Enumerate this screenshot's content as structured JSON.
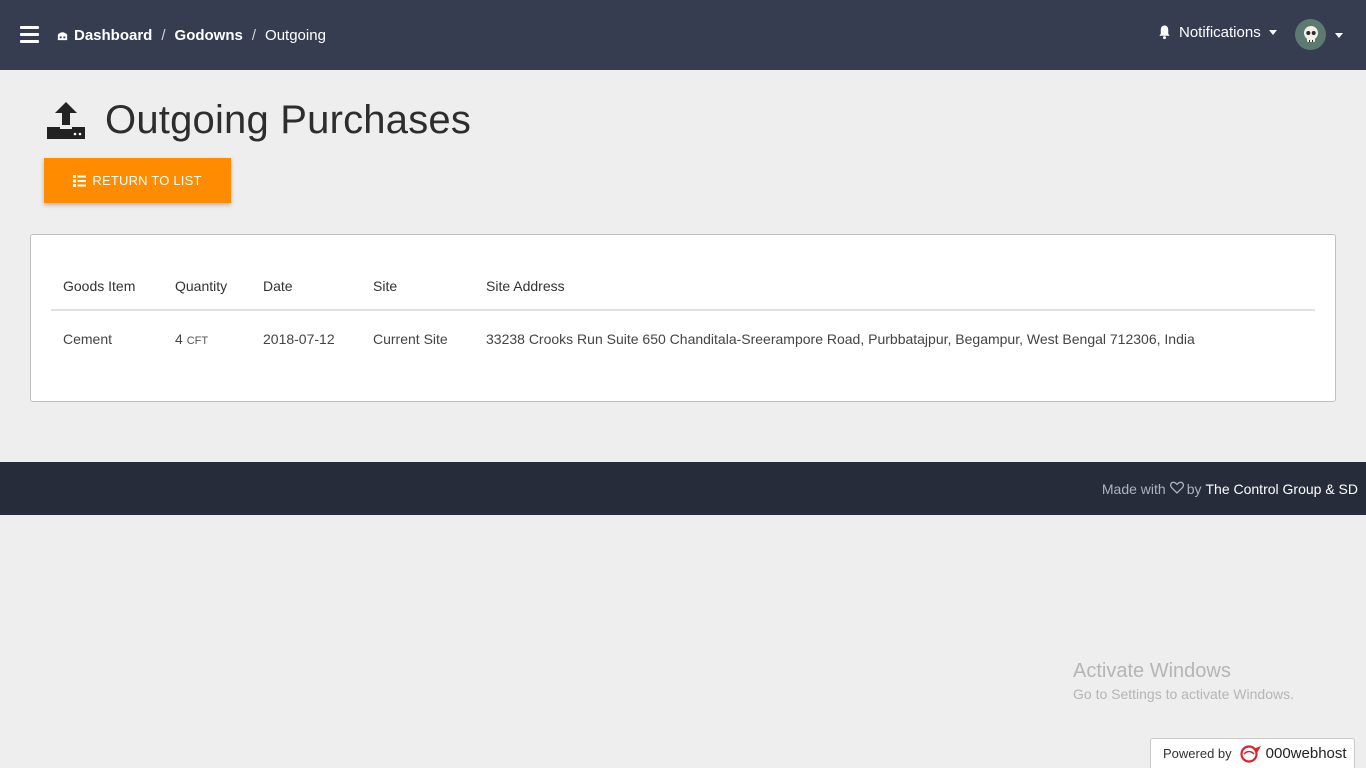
{
  "navbar": {
    "breadcrumb": {
      "home": "Dashboard",
      "parent": "Godowns",
      "current": "Outgoing",
      "separator": "/"
    },
    "notifications_label": "Notifications"
  },
  "header": {
    "title": "Outgoing Purchases",
    "return_button": "RETURN TO LIST"
  },
  "table": {
    "columns": [
      "Goods Item",
      "Quantity",
      "Date",
      "Site",
      "Site Address"
    ],
    "rows": [
      {
        "goods_item": "Cement",
        "quantity": "4",
        "unit": "CFT",
        "date": "2018-07-12",
        "site": "Current Site",
        "site_address": "33238 Crooks Run Suite 650 Chanditala-Sreerampore Road, Purbbatajpur, Begampur, West Bengal 712306, India"
      }
    ]
  },
  "footer": {
    "made_with": "Made with",
    "by": "by",
    "brand": "The Control Group & SD"
  },
  "watermark": {
    "title": "Activate Windows",
    "subtitle": "Go to Settings to activate Windows."
  },
  "powered_badge": {
    "label": "Powered by",
    "host": "000webhost"
  },
  "colors": {
    "navbar": "#373d50",
    "footer": "#272c3a",
    "accent": "#ff8c00",
    "background": "#eeeeee"
  },
  "icons": {
    "menu": "hamburger-icon",
    "home": "home-icon",
    "bell": "bell-icon",
    "avatar": "skull-icon",
    "title": "upload-icon",
    "button": "list-icon",
    "heart": "heart-icon",
    "host_logo": "000webhost-logo"
  }
}
